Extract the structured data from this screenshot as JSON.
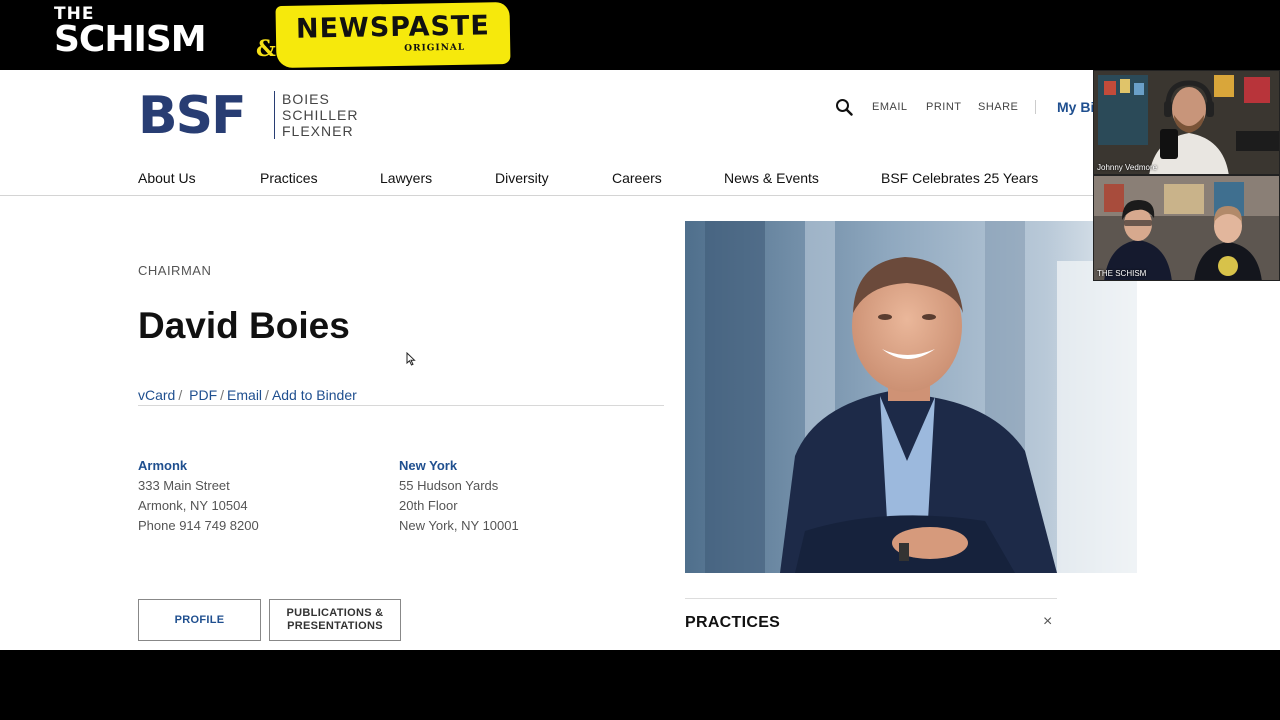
{
  "overlay": {
    "show_the": "THE",
    "show_name": "SCHISM",
    "ampersand": "&",
    "partner_name": "NEWSPASTE",
    "partner_tag": "ORIGINAL"
  },
  "site": {
    "logo_mark": "BSF",
    "logo_words": [
      "BOIES",
      "SCHILLER",
      "FLEXNER"
    ],
    "utility": {
      "search_icon": "search-icon",
      "email": "EMAIL",
      "print": "PRINT",
      "share": "SHARE",
      "binder": "My Bi"
    },
    "nav": [
      "About Us",
      "Practices",
      "Lawyers",
      "Diversity",
      "Careers",
      "News & Events",
      "BSF Celebrates 25 Years"
    ]
  },
  "profile": {
    "role": "CHAIRMAN",
    "name": "David Boies",
    "actions": {
      "vcard": "vCard",
      "pdf": "PDF",
      "email": "Email",
      "binder": "Add to Binder",
      "separator": "/"
    },
    "offices": [
      {
        "city": "Armonk",
        "lines": [
          "333 Main Street",
          "Armonk, NY 10504",
          "Phone 914 749 8200"
        ]
      },
      {
        "city": "New York",
        "lines": [
          "55 Hudson Yards",
          "20th Floor",
          "New York, NY 10001"
        ]
      }
    ],
    "tabs": {
      "profile": "PROFILE",
      "publications_line1": "PUBLICATIONS &",
      "publications_line2": "PRESENTATIONS"
    },
    "practices_heading": "PRACTICES",
    "practices_close": "×"
  },
  "webcams": {
    "top_label": "Johnny Vedmore",
    "bottom_label": "THE SCHISM"
  },
  "colors": {
    "brand_navy": "#283d73",
    "link_blue": "#1f4f8f",
    "badge_yellow": "#f6e90c"
  }
}
